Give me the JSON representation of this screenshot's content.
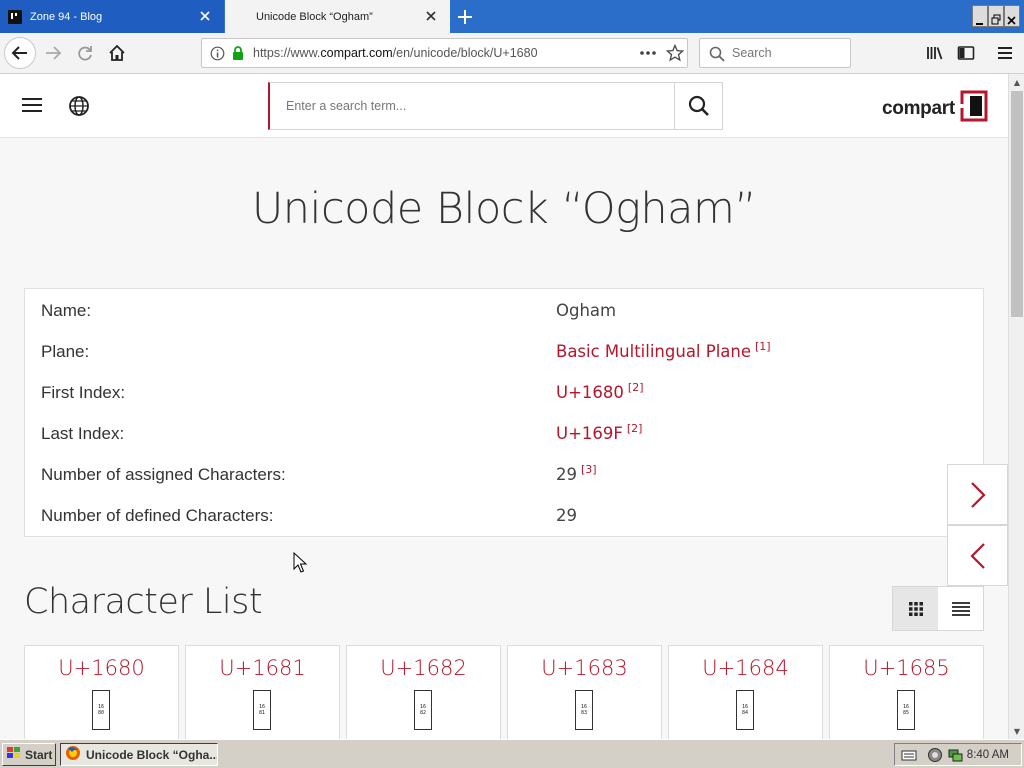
{
  "browser": {
    "tabs": [
      {
        "title": "Zone 94 - Blog",
        "active": false
      },
      {
        "title": "Unicode Block “Ogham”",
        "active": true
      }
    ],
    "url_prefix": "https://www.",
    "url_domain": "compart.com",
    "url_path": "/en/unicode/block/U+1680",
    "search_placeholder": "Search"
  },
  "site": {
    "search_placeholder": "Enter a search term...",
    "logo_text": "compart",
    "brand_color": "#b5162b"
  },
  "page": {
    "title": "Unicode Block “Ogham”",
    "info": [
      {
        "label": "Name:",
        "value": "Ogham",
        "ref": "",
        "link": false
      },
      {
        "label": "Plane:",
        "value": "Basic Multilingual Plane",
        "ref": "[1]",
        "link": true
      },
      {
        "label": "First Index:",
        "value": "U+1680",
        "ref": "[2]",
        "link": true
      },
      {
        "label": "Last Index:",
        "value": "U+169F",
        "ref": "[2]",
        "link": true
      },
      {
        "label": "Number of assigned Characters:",
        "value": "29",
        "ref": "[3]",
        "link": false
      },
      {
        "label": "Number of defined Characters:",
        "value": "29",
        "ref": "",
        "link": false
      }
    ],
    "char_list_title": "Character List",
    "characters": [
      {
        "code": "U+1680",
        "glyph_top": "16",
        "glyph_bottom": "80"
      },
      {
        "code": "U+1681",
        "glyph_top": "16",
        "glyph_bottom": "81"
      },
      {
        "code": "U+1682",
        "glyph_top": "16",
        "glyph_bottom": "82"
      },
      {
        "code": "U+1683",
        "glyph_top": "16",
        "glyph_bottom": "83"
      },
      {
        "code": "U+1684",
        "glyph_top": "16",
        "glyph_bottom": "84"
      },
      {
        "code": "U+1685",
        "glyph_top": "16",
        "glyph_bottom": "85"
      }
    ]
  },
  "taskbar": {
    "start_label": "Start",
    "task_label": "Unicode Block “Ogha...",
    "clock": "8:40 AM"
  }
}
